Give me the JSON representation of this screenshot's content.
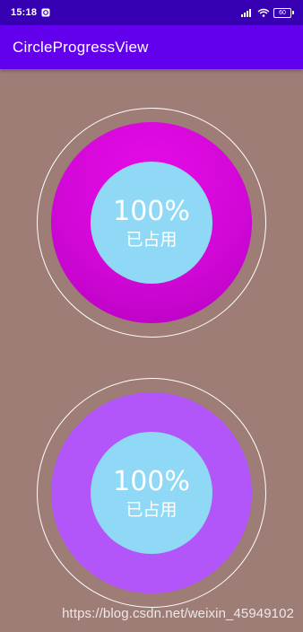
{
  "status_bar": {
    "time": "15:18",
    "battery": "60",
    "icons": [
      "notification-icon",
      "signal-icon",
      "wifi-icon",
      "battery-icon"
    ]
  },
  "app_bar": {
    "title": "CircleProgressView"
  },
  "gauges": [
    {
      "percent_text": "100%",
      "caption": "已占用",
      "progress": 1.0,
      "colors": {
        "progress": "#D108D6",
        "inner": "#8FD9F7",
        "ring": "#FFFFFF"
      }
    },
    {
      "percent_text": "100%",
      "caption": "已占用",
      "progress": 1.0,
      "colors": {
        "progress": "#B255F9",
        "inner": "#8FD9F7",
        "ring": "#FFFFFF"
      }
    }
  ],
  "watermark": "https://blog.csdn.net/weixin_45949102",
  "colors": {
    "status_bar": "#3700B3",
    "app_bar": "#6200EE",
    "background": "#9E7D77"
  }
}
